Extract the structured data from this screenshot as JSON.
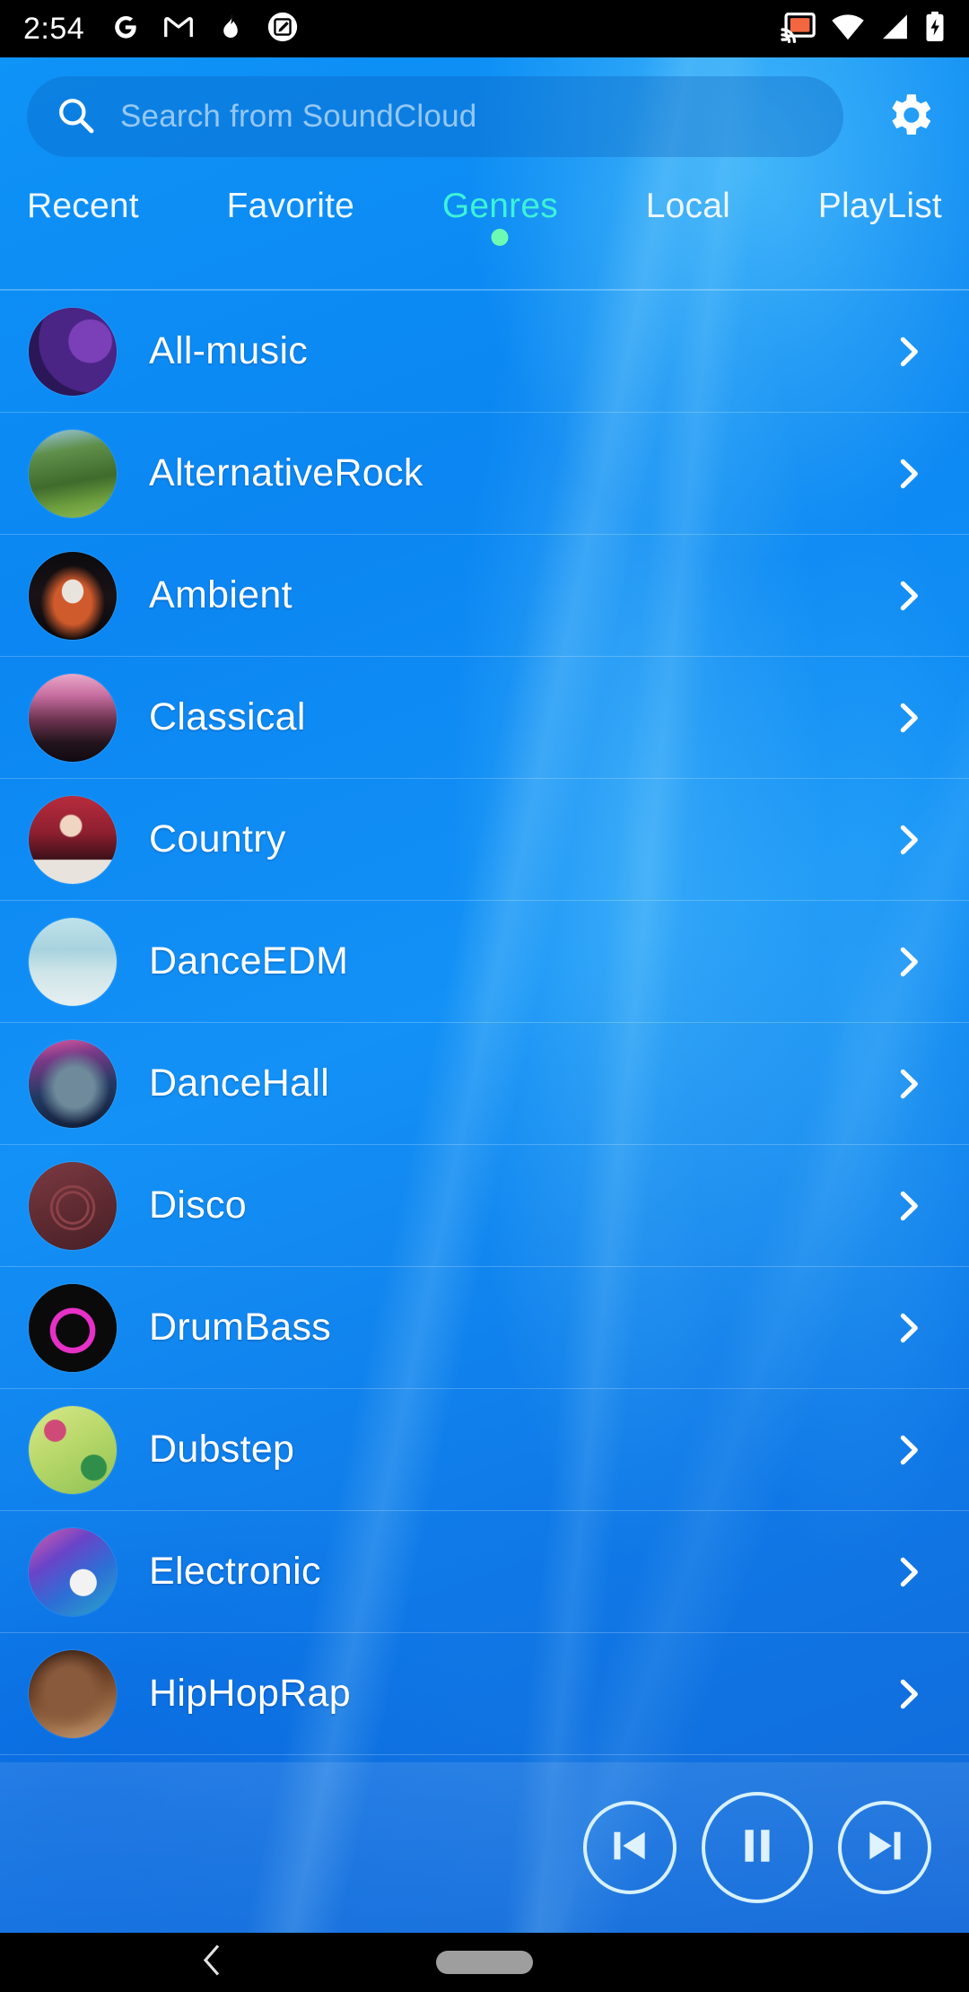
{
  "status_bar": {
    "time": "2:54",
    "left_icons": [
      "google-icon",
      "gmail-icon",
      "flame-icon",
      "screenshot-edit-icon"
    ],
    "right_icons": [
      "cast-icon",
      "wifi-icon",
      "cellular-signal-icon",
      "battery-charging-icon"
    ],
    "cast_icon_color": "#f2673f"
  },
  "search": {
    "placeholder": "Search from SoundCloud",
    "icon": "search-icon"
  },
  "settings": {
    "icon": "gear-icon",
    "label": "Settings"
  },
  "tabs": {
    "active_index": 2,
    "active_color": "#3df2d8",
    "indicator_color": "#6dfbb4",
    "items": [
      {
        "label": "Recent"
      },
      {
        "label": "Favorite"
      },
      {
        "label": "Genres"
      },
      {
        "label": "Local"
      },
      {
        "label": "PlayList"
      }
    ]
  },
  "genre_list": {
    "chevron_icon": "chevron-right-icon",
    "items": [
      {
        "label": "All-music",
        "art": "portrait-man-purple"
      },
      {
        "label": "AlternativeRock",
        "art": "forest-green"
      },
      {
        "label": "Ambient",
        "art": "dont-let-me-down-dark"
      },
      {
        "label": "Classical",
        "art": "singer-stage-pink"
      },
      {
        "label": "Country",
        "art": "voce-faz-falta-aqui"
      },
      {
        "label": "DanceEDM",
        "art": "in-the-name-of-love-pale"
      },
      {
        "label": "DanceHall",
        "art": "rihanna-face-blue"
      },
      {
        "label": "Disco",
        "art": "oliver-nelson-maroon"
      },
      {
        "label": "DrumBass",
        "art": "magenta-ring-black"
      },
      {
        "label": "Dubstep",
        "art": "suicide-squad-green"
      },
      {
        "label": "Electronic",
        "art": "marshmello-colorful"
      },
      {
        "label": "HipHopRap",
        "art": "rapper-brown"
      }
    ]
  },
  "player": {
    "previous_label": "Previous",
    "play_pause_label": "Pause",
    "next_label": "Next",
    "previous_icon": "skip-previous-icon",
    "play_pause_icon": "pause-icon",
    "next_icon": "skip-next-icon",
    "state": "playing"
  },
  "navigation_bar": {
    "back_icon": "back-chevron-icon",
    "home_icon": "home-pill-icon"
  },
  "theme": {
    "background_top": "#0e93f7",
    "background_bottom": "#1268d8",
    "text_primary": "#ffffff",
    "divider": "rgba(255,255,255,0.22)"
  }
}
